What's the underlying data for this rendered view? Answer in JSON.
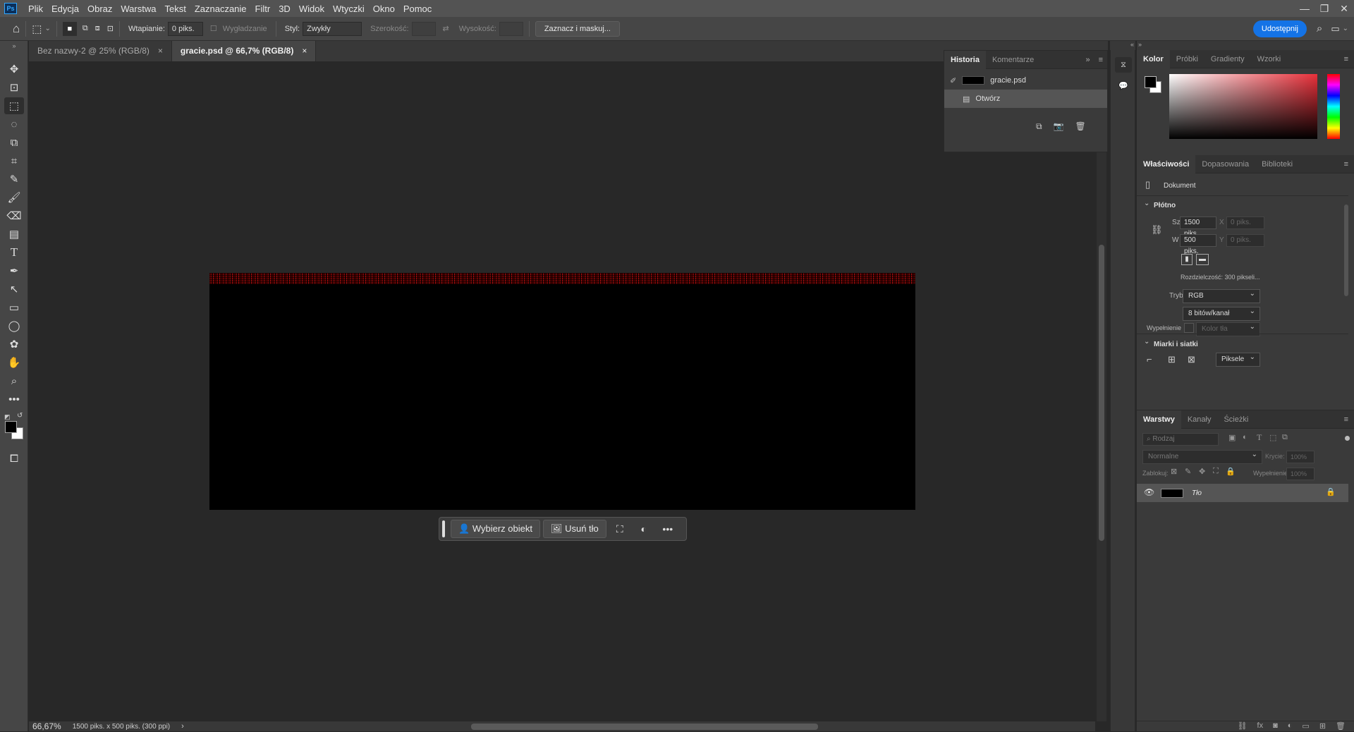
{
  "menubar": {
    "logo": "Ps",
    "items": [
      "Plik",
      "Edycja",
      "Obraz",
      "Warstwa",
      "Tekst",
      "Zaznaczanie",
      "Filtr",
      "3D",
      "Widok",
      "Wtyczki",
      "Okno",
      "Pomoc"
    ],
    "window_controls": [
      "—",
      "❐",
      "✕"
    ]
  },
  "options": {
    "feather_label": "Wtapianie:",
    "feather_value": "0 piks.",
    "antialias_label": "Wygładzanie",
    "style_label": "Styl:",
    "style_value": "Zwykły",
    "width_label": "Szerokość:",
    "height_label": "Wysokość:",
    "select_mask_button": "Zaznacz i maskuj...",
    "share_button": "Udostępnij",
    "share_color": "#1473e6"
  },
  "tabs": [
    {
      "label": "Bez nazwy-2 @ 25% (RGB/8)",
      "close": "×"
    },
    {
      "label": "gracie.psd @ 66,7% (RGB/8)",
      "close": "×"
    }
  ],
  "context_bar": {
    "select_subject": "Wybierz obiekt",
    "remove_bg": "Usuń tło",
    "more": "•••"
  },
  "status": {
    "zoom": "66,67%",
    "doc_info": "1500 piks. x 500 piks. (300 ppi)",
    "arrow": "›"
  },
  "history": {
    "tabs": [
      "Historia",
      "Komentarze"
    ],
    "snapshot": "gracie.psd",
    "steps": [
      "Otwórz"
    ]
  },
  "color_panel": {
    "tabs": [
      "Kolor",
      "Próbki",
      "Gradienty",
      "Wzorki"
    ],
    "fg": "#000000",
    "bg": "#ffffff",
    "hue": "#e8303a"
  },
  "properties": {
    "tabs": [
      "Właściwości",
      "Dopasowania",
      "Biblioteki"
    ],
    "doc_label": "Dokument",
    "canvas_section": "Płótno",
    "w_label": "Sz",
    "w_value": "1500 piks.",
    "h_label": "W",
    "h_value": "500 piks.",
    "x_label": "X",
    "x_value": "0 piks.",
    "y_label": "Y",
    "y_value": "0 piks.",
    "resolution": "Rozdzielczość:  300  pikseli...",
    "mode_label": "Tryb",
    "mode_value": "RGB",
    "depth_value": "8 bitów/kanał",
    "fill_label": "Wypełnienie",
    "fill_value": "Kolor tła",
    "rulers_section": "Miarki i siatki",
    "units_value": "Piksele"
  },
  "layers": {
    "tabs": [
      "Warstwy",
      "Kanały",
      "Ścieżki"
    ],
    "filter_placeholder": "Rodzaj",
    "blend_mode": "Normalne",
    "opacity_label": "Krycie:",
    "opacity_value": "100%",
    "lock_label": "Zablokuj:",
    "fill_label": "Wypełnienie:",
    "fill_value": "100%",
    "items": [
      {
        "name": "Tło"
      }
    ]
  }
}
